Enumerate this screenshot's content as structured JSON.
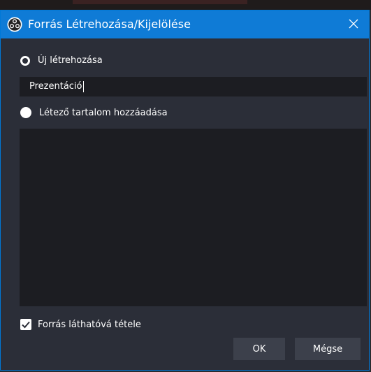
{
  "dialog": {
    "title": "Forrás Létrehozása/Kijelölése",
    "icon": "obs-logo-icon",
    "close_icon": "close-icon"
  },
  "options": {
    "create_new_label": "Új létrehozása",
    "create_new_selected": false,
    "name_value": "Prezentáció",
    "add_existing_label": "Létező tartalom hozzáadása",
    "add_existing_selected": true,
    "existing_items": []
  },
  "visibility": {
    "label": "Forrás láthatóvá tétele",
    "checked": true
  },
  "buttons": {
    "ok_label": "OK",
    "cancel_label": "Mégse"
  },
  "colors": {
    "titlebar": "#0f7bd6",
    "background": "#2b2e38",
    "field": "#1c1d22",
    "button": "#3c404b"
  }
}
